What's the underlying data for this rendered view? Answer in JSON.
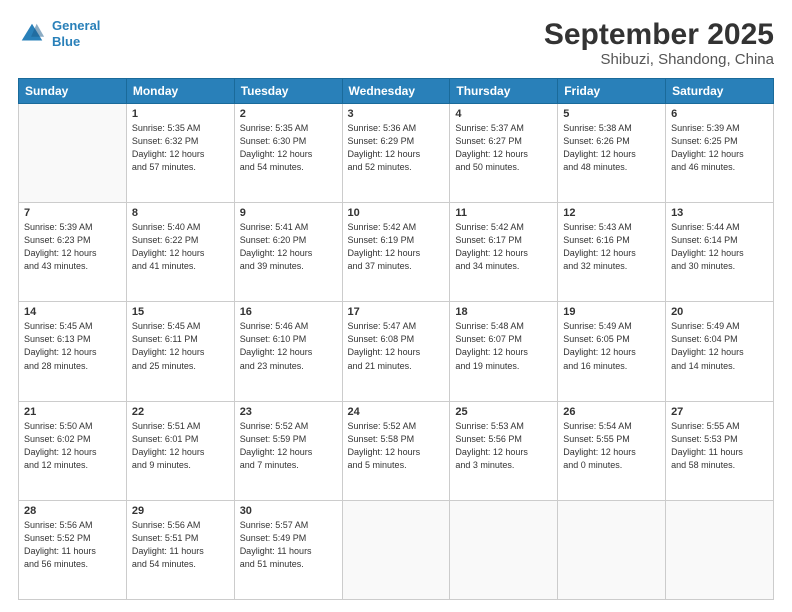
{
  "header": {
    "logo_line1": "General",
    "logo_line2": "Blue",
    "title": "September 2025",
    "subtitle": "Shibuzi, Shandong, China"
  },
  "weekdays": [
    "Sunday",
    "Monday",
    "Tuesday",
    "Wednesday",
    "Thursday",
    "Friday",
    "Saturday"
  ],
  "weeks": [
    [
      {
        "day": "",
        "info": ""
      },
      {
        "day": "1",
        "info": "Sunrise: 5:35 AM\nSunset: 6:32 PM\nDaylight: 12 hours\nand 57 minutes."
      },
      {
        "day": "2",
        "info": "Sunrise: 5:35 AM\nSunset: 6:30 PM\nDaylight: 12 hours\nand 54 minutes."
      },
      {
        "day": "3",
        "info": "Sunrise: 5:36 AM\nSunset: 6:29 PM\nDaylight: 12 hours\nand 52 minutes."
      },
      {
        "day": "4",
        "info": "Sunrise: 5:37 AM\nSunset: 6:27 PM\nDaylight: 12 hours\nand 50 minutes."
      },
      {
        "day": "5",
        "info": "Sunrise: 5:38 AM\nSunset: 6:26 PM\nDaylight: 12 hours\nand 48 minutes."
      },
      {
        "day": "6",
        "info": "Sunrise: 5:39 AM\nSunset: 6:25 PM\nDaylight: 12 hours\nand 46 minutes."
      }
    ],
    [
      {
        "day": "7",
        "info": "Sunrise: 5:39 AM\nSunset: 6:23 PM\nDaylight: 12 hours\nand 43 minutes."
      },
      {
        "day": "8",
        "info": "Sunrise: 5:40 AM\nSunset: 6:22 PM\nDaylight: 12 hours\nand 41 minutes."
      },
      {
        "day": "9",
        "info": "Sunrise: 5:41 AM\nSunset: 6:20 PM\nDaylight: 12 hours\nand 39 minutes."
      },
      {
        "day": "10",
        "info": "Sunrise: 5:42 AM\nSunset: 6:19 PM\nDaylight: 12 hours\nand 37 minutes."
      },
      {
        "day": "11",
        "info": "Sunrise: 5:42 AM\nSunset: 6:17 PM\nDaylight: 12 hours\nand 34 minutes."
      },
      {
        "day": "12",
        "info": "Sunrise: 5:43 AM\nSunset: 6:16 PM\nDaylight: 12 hours\nand 32 minutes."
      },
      {
        "day": "13",
        "info": "Sunrise: 5:44 AM\nSunset: 6:14 PM\nDaylight: 12 hours\nand 30 minutes."
      }
    ],
    [
      {
        "day": "14",
        "info": "Sunrise: 5:45 AM\nSunset: 6:13 PM\nDaylight: 12 hours\nand 28 minutes."
      },
      {
        "day": "15",
        "info": "Sunrise: 5:45 AM\nSunset: 6:11 PM\nDaylight: 12 hours\nand 25 minutes."
      },
      {
        "day": "16",
        "info": "Sunrise: 5:46 AM\nSunset: 6:10 PM\nDaylight: 12 hours\nand 23 minutes."
      },
      {
        "day": "17",
        "info": "Sunrise: 5:47 AM\nSunset: 6:08 PM\nDaylight: 12 hours\nand 21 minutes."
      },
      {
        "day": "18",
        "info": "Sunrise: 5:48 AM\nSunset: 6:07 PM\nDaylight: 12 hours\nand 19 minutes."
      },
      {
        "day": "19",
        "info": "Sunrise: 5:49 AM\nSunset: 6:05 PM\nDaylight: 12 hours\nand 16 minutes."
      },
      {
        "day": "20",
        "info": "Sunrise: 5:49 AM\nSunset: 6:04 PM\nDaylight: 12 hours\nand 14 minutes."
      }
    ],
    [
      {
        "day": "21",
        "info": "Sunrise: 5:50 AM\nSunset: 6:02 PM\nDaylight: 12 hours\nand 12 minutes."
      },
      {
        "day": "22",
        "info": "Sunrise: 5:51 AM\nSunset: 6:01 PM\nDaylight: 12 hours\nand 9 minutes."
      },
      {
        "day": "23",
        "info": "Sunrise: 5:52 AM\nSunset: 5:59 PM\nDaylight: 12 hours\nand 7 minutes."
      },
      {
        "day": "24",
        "info": "Sunrise: 5:52 AM\nSunset: 5:58 PM\nDaylight: 12 hours\nand 5 minutes."
      },
      {
        "day": "25",
        "info": "Sunrise: 5:53 AM\nSunset: 5:56 PM\nDaylight: 12 hours\nand 3 minutes."
      },
      {
        "day": "26",
        "info": "Sunrise: 5:54 AM\nSunset: 5:55 PM\nDaylight: 12 hours\nand 0 minutes."
      },
      {
        "day": "27",
        "info": "Sunrise: 5:55 AM\nSunset: 5:53 PM\nDaylight: 11 hours\nand 58 minutes."
      }
    ],
    [
      {
        "day": "28",
        "info": "Sunrise: 5:56 AM\nSunset: 5:52 PM\nDaylight: 11 hours\nand 56 minutes."
      },
      {
        "day": "29",
        "info": "Sunrise: 5:56 AM\nSunset: 5:51 PM\nDaylight: 11 hours\nand 54 minutes."
      },
      {
        "day": "30",
        "info": "Sunrise: 5:57 AM\nSunset: 5:49 PM\nDaylight: 11 hours\nand 51 minutes."
      },
      {
        "day": "",
        "info": ""
      },
      {
        "day": "",
        "info": ""
      },
      {
        "day": "",
        "info": ""
      },
      {
        "day": "",
        "info": ""
      }
    ]
  ]
}
